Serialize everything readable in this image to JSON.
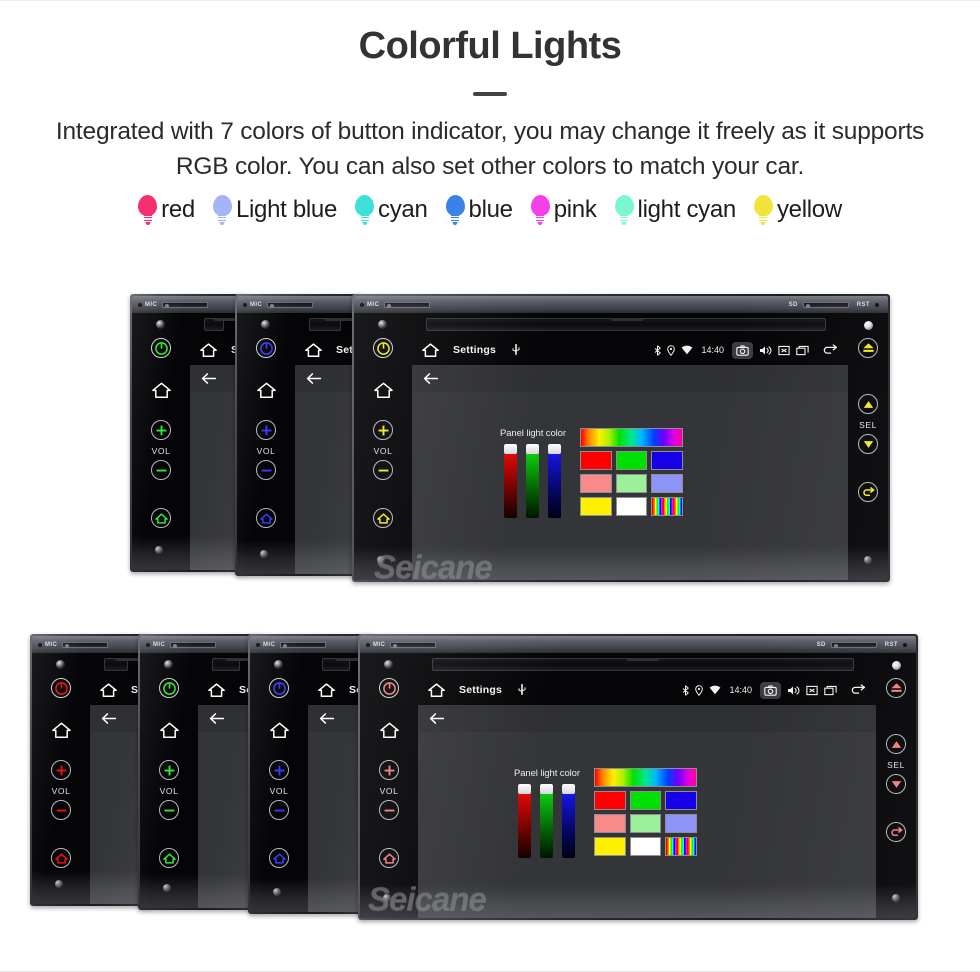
{
  "header": {
    "title": "Colorful Lights",
    "description": "Integrated with 7 colors of button indicator, you may change it freely as it supports RGB color. You can also set other colors to match your car."
  },
  "legend": {
    "items": [
      {
        "label": "red",
        "color": "#f5306e",
        "icon": "bulb-icon"
      },
      {
        "label": "Light blue",
        "color": "#a3b4f7",
        "icon": "bulb-icon"
      },
      {
        "label": "cyan",
        "color": "#3ee0d8",
        "icon": "bulb-icon"
      },
      {
        "label": "blue",
        "color": "#3b82e8",
        "icon": "bulb-icon"
      },
      {
        "label": "pink",
        "color": "#f340e8",
        "icon": "bulb-icon"
      },
      {
        "label": "light cyan",
        "color": "#7cf5d2",
        "icon": "bulb-icon"
      },
      {
        "label": "yellow",
        "color": "#f2e33c",
        "icon": "bulb-icon"
      }
    ]
  },
  "bezel": {
    "mic_label": "MIC",
    "sd_label": "SD",
    "rst_label": "RST"
  },
  "keys": {
    "vol_label": "VOL",
    "sel_label": "SEL",
    "power_icon": "power-icon",
    "home_icon": "home-icon",
    "vol_up_icon": "plus-circle-icon",
    "vol_down_icon": "minus-circle-icon",
    "mode_icon": "mode-home-icon",
    "eject_icon": "eject-icon",
    "up_icon": "triangle-up-icon",
    "down_icon": "triangle-down-icon",
    "back_icon": "back-arrow-icon"
  },
  "screen": {
    "title": "Settings",
    "home_icon": "home-outline-icon",
    "usb_icon": "usb-icon",
    "back_icon": "back-arrow-icon",
    "clock": "14:40",
    "status_icons": [
      "bluetooth-icon",
      "location-icon",
      "wifi-icon",
      "camera-icon",
      "volume-icon",
      "close-box-icon",
      "recent-apps-icon",
      "back-arrow-icon"
    ]
  },
  "panel_light": {
    "caption": "Panel light color",
    "sliders": [
      {
        "name": "red-slider",
        "color": "#ff1111",
        "value": 100
      },
      {
        "name": "green-slider",
        "color": "#16e416",
        "value": 100
      },
      {
        "name": "blue-slider",
        "color": "#2222ff",
        "value": 100
      }
    ],
    "hue_bar": "hue-gradient-bar",
    "swatch_rows": [
      [
        {
          "name": "swatch-red",
          "color": "#ff0000"
        },
        {
          "name": "swatch-green",
          "color": "#00e000"
        },
        {
          "name": "swatch-blue",
          "color": "#1500e8"
        }
      ],
      [
        {
          "name": "swatch-salmon",
          "color": "#f98a8a"
        },
        {
          "name": "swatch-lightgreen",
          "color": "#9cf09c"
        },
        {
          "name": "swatch-periwinkle",
          "color": "#8e94f5"
        }
      ],
      [
        {
          "name": "swatch-yellow",
          "color": "#fff000"
        },
        {
          "name": "swatch-white",
          "color": "#ffffff"
        },
        {
          "name": "swatch-rainbow",
          "color": "rainbow"
        }
      ]
    ]
  },
  "groups": [
    {
      "name": "group-top",
      "units": [
        {
          "name": "unit-green",
          "accent": "#2eea2e",
          "led": "#2eea2e",
          "has_screen": false
        },
        {
          "name": "unit-blue",
          "accent": "#3a3aff",
          "led": "#2a2aff",
          "has_screen": false
        },
        {
          "name": "unit-yellow",
          "accent": "#f2e91e",
          "led": "#f2e91e",
          "has_screen": true
        }
      ]
    },
    {
      "name": "group-bottom",
      "units": [
        {
          "name": "unit-red",
          "accent": "#f01010",
          "led": "#e81010",
          "has_screen": false
        },
        {
          "name": "unit-green",
          "accent": "#2eea2e",
          "led": "#2eea2e",
          "has_screen": false
        },
        {
          "name": "unit-blue",
          "accent": "#3a3aff",
          "led": "#2a2aff",
          "has_screen": false
        },
        {
          "name": "unit-salmon",
          "accent": "#f27c7c",
          "led": "#f06a6a",
          "has_screen": true
        }
      ]
    }
  ],
  "watermark": {
    "text": "Seicane"
  }
}
